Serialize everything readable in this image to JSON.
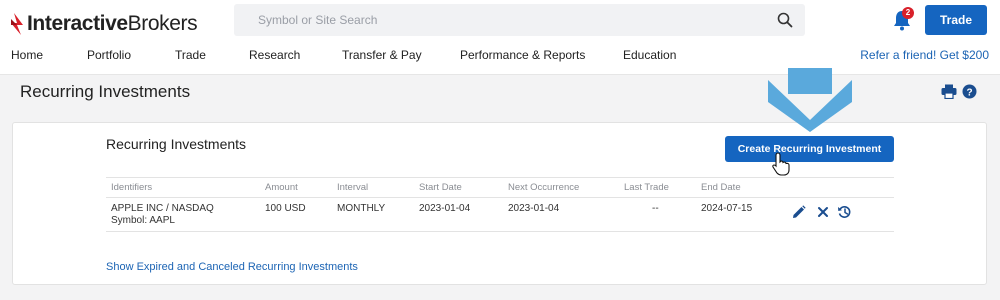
{
  "brand": {
    "name_bold": "Interactive",
    "name_light": "Brokers"
  },
  "search": {
    "placeholder": "Symbol or Site Search"
  },
  "notifications": {
    "count": "2"
  },
  "header": {
    "trade_label": "Trade"
  },
  "nav": {
    "items": [
      "Home",
      "Portfolio",
      "Trade",
      "Research",
      "Transfer & Pay",
      "Performance & Reports",
      "Education"
    ],
    "refer": "Refer a friend! Get $200"
  },
  "page": {
    "title": "Recurring Investments"
  },
  "card": {
    "title": "Recurring Investments",
    "create_label": "Create Recurring Investment",
    "columns": [
      "Identifiers",
      "Amount",
      "Interval",
      "Start Date",
      "Next Occurrence",
      "Last Trade",
      "End Date"
    ],
    "rows": [
      {
        "identifier": "APPLE INC / NASDAQ",
        "symbol": "Symbol: AAPL",
        "amount": "100 USD",
        "interval": "MONTHLY",
        "start_date": "2023-01-04",
        "next_occurrence": "2023-01-04",
        "last_trade": "--",
        "end_date": "2024-07-15"
      }
    ],
    "expired_link": "Show Expired and Canceled Recurring Investments"
  },
  "colors": {
    "accent_blue": "#1565c0",
    "link_blue": "#1c64b4",
    "logo_red": "#d8202a",
    "arrow_blue": "#5aa9dc"
  },
  "icons": [
    "logo-flame-icon",
    "search-icon",
    "bell-icon",
    "print-icon",
    "help-icon",
    "edit-icon",
    "cancel-icon",
    "history-icon",
    "pointer-cursor-icon",
    "down-arrow-icon"
  ]
}
